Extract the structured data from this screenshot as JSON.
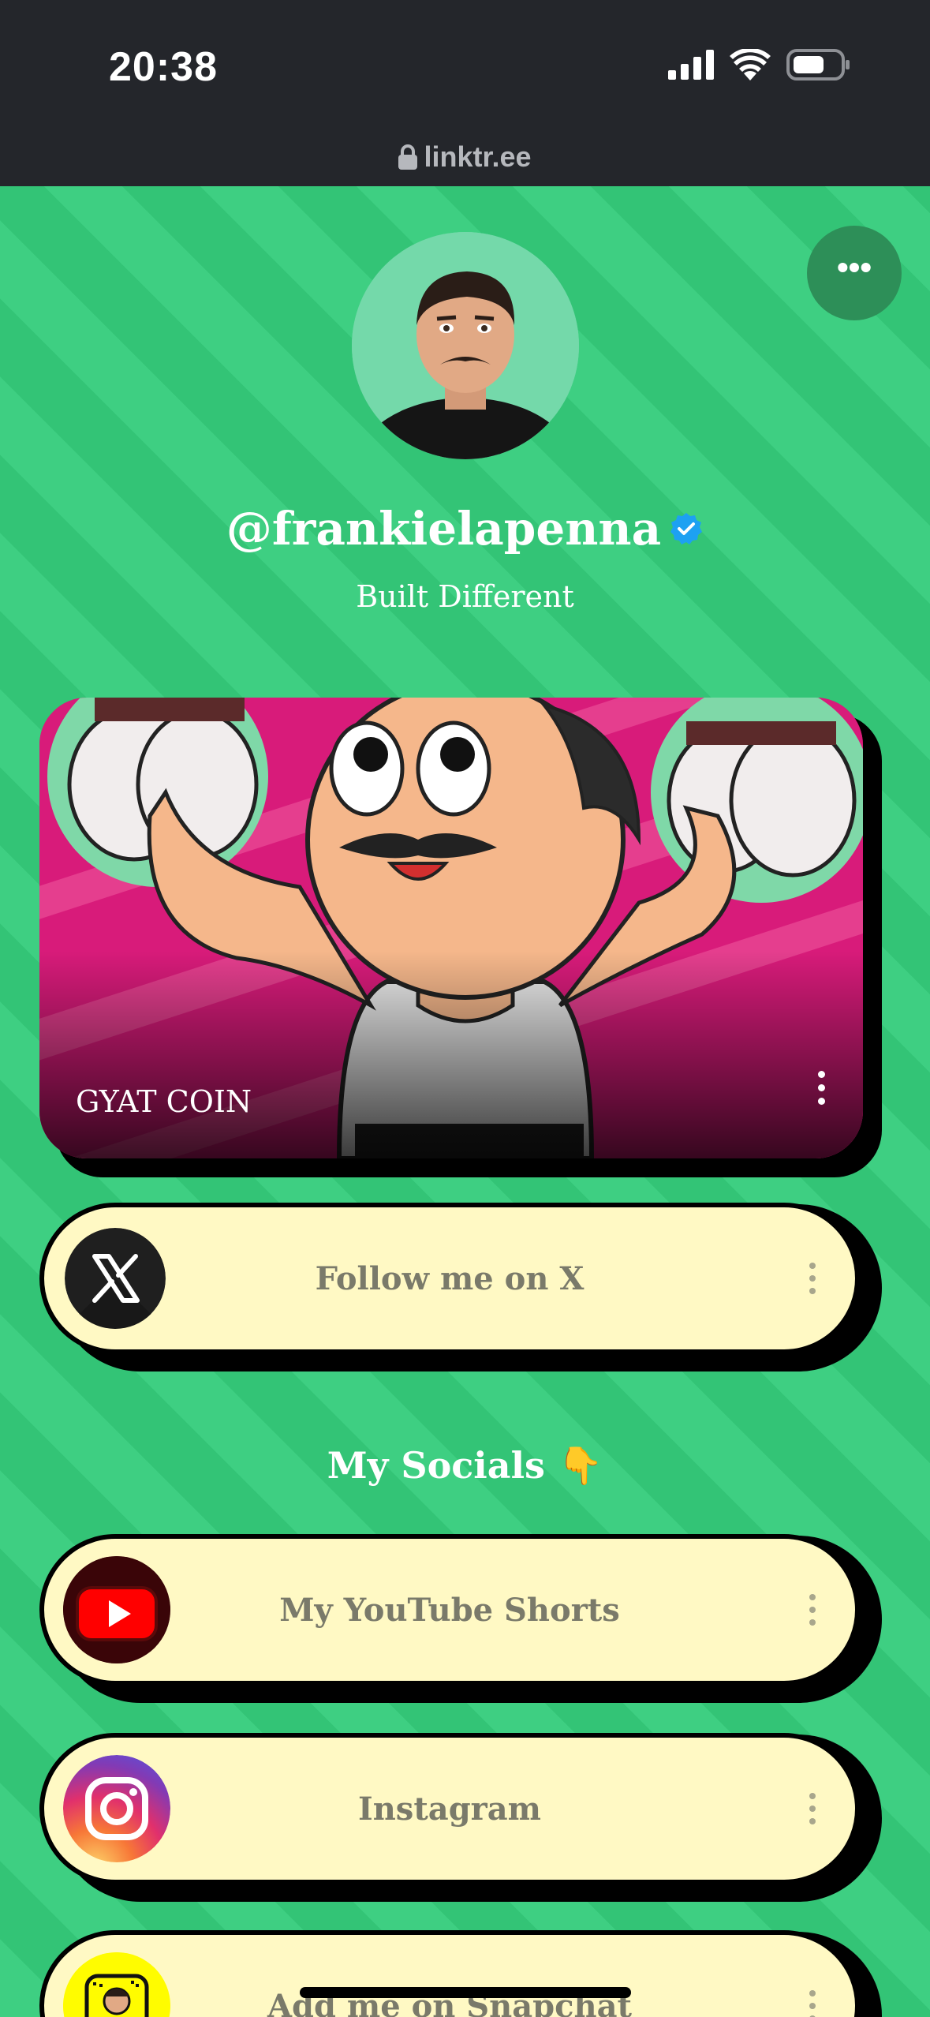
{
  "status_bar": {
    "time": "20:38"
  },
  "browser": {
    "url": "linktr.ee"
  },
  "profile": {
    "more_glyph": "•••",
    "handle": "@frankielapenna",
    "bio": "Built Different"
  },
  "featured_link": {
    "title": "GYAT COIN"
  },
  "links": [
    {
      "label": "Follow me on X",
      "icon": "x-logo-icon"
    }
  ],
  "sections": [
    {
      "header": "My Socials 👇",
      "links": [
        {
          "label": "My YouTube Shorts",
          "icon": "youtube-icon"
        },
        {
          "label": "Instagram",
          "icon": "instagram-icon"
        },
        {
          "label": "Add me on Snapchat",
          "icon": "snapchat-icon"
        }
      ]
    }
  ],
  "colors": {
    "background": "#3ecf82",
    "button_fill": "#fff9c4",
    "button_text": "#7a7a6a",
    "status_bar": "#24262b"
  }
}
